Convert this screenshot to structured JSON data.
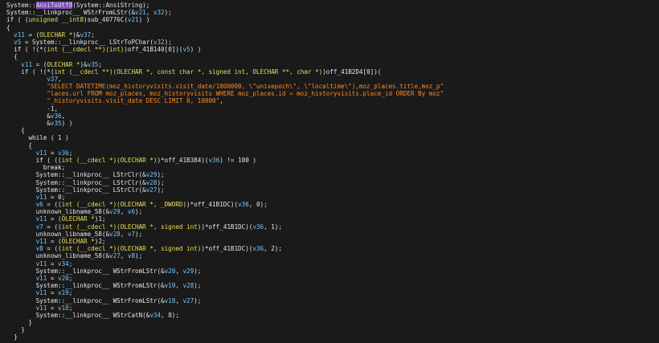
{
  "colors": {
    "background": "#1a1a1a",
    "text": "#e6e6e6",
    "type": "#e7e05a",
    "variable": "#76c8ff",
    "string": "#ff8a1f",
    "highlight": "#7a48b8"
  },
  "lines": [
    [
      [
        "plain",
        "System::"
      ],
      [
        "hl",
        "AnsiToUtf8"
      ],
      [
        "plain",
        "(System::AnsiString);"
      ]
    ],
    [
      [
        "plain",
        "System::__linkproc__ WStrFromLStr(&"
      ],
      [
        "var",
        "v21"
      ],
      [
        "plain",
        ", "
      ],
      [
        "var",
        "v32"
      ],
      [
        "plain",
        ");"
      ]
    ],
    [
      [
        "kw",
        "if"
      ],
      [
        "plain",
        " ( ("
      ],
      [
        "type",
        "unsigned __int8"
      ],
      [
        "plain",
        ")sub_40776C("
      ],
      [
        "var",
        "v21"
      ],
      [
        "plain",
        ") )"
      ]
    ],
    [
      [
        "plain",
        "{"
      ]
    ],
    [
      [
        "plain",
        "  "
      ],
      [
        "var",
        "v11"
      ],
      [
        "plain",
        " = ("
      ],
      [
        "type",
        "OLECHAR *"
      ],
      [
        "plain",
        ")&"
      ],
      [
        "var",
        "v37"
      ],
      [
        "plain",
        ";"
      ]
    ],
    [
      [
        "plain",
        "  "
      ],
      [
        "var",
        "v5"
      ],
      [
        "plain",
        " = System::__linkproc__ LStrToPChar("
      ],
      [
        "var",
        "v32"
      ],
      [
        "plain",
        ");"
      ]
    ],
    [
      [
        "plain",
        "  "
      ],
      [
        "kw",
        "if"
      ],
      [
        "plain",
        " ( !(*("
      ],
      [
        "type",
        "int (__cdecl **)(int)"
      ],
      [
        "plain",
        ")off_41B140[0])("
      ],
      [
        "var",
        "v5"
      ],
      [
        "plain",
        ") )"
      ]
    ],
    [
      [
        "plain",
        "  {"
      ]
    ],
    [
      [
        "plain",
        "    "
      ],
      [
        "var",
        "v11"
      ],
      [
        "plain",
        " = ("
      ],
      [
        "type",
        "OLECHAR *"
      ],
      [
        "plain",
        ")&"
      ],
      [
        "var",
        "v35"
      ],
      [
        "plain",
        ";"
      ]
    ],
    [
      [
        "plain",
        "    "
      ],
      [
        "kw",
        "if"
      ],
      [
        "plain",
        " ( !(*("
      ],
      [
        "type",
        "int (__cdecl **)(OLECHAR *, const char *, signed int, OLECHAR **, char *)"
      ],
      [
        "plain",
        ")off_41B2D4[0])("
      ]
    ],
    [
      [
        "plain",
        "           "
      ],
      [
        "var",
        "v37"
      ],
      [
        "plain",
        ","
      ]
    ],
    [
      [
        "plain",
        "           "
      ],
      [
        "str",
        "\"SELECT DATETIME(moz_historyvisits.visit_date/1000000, \\\"unixepoch\\\", \\\"localtime\\\"),moz_places.title,moz_p\""
      ]
    ],
    [
      [
        "plain",
        "           "
      ],
      [
        "str",
        "\"laces.url FROM moz_places, moz_historyvisits WHERE moz_places.id = moz_historyvisits.place_id ORDER By moz\""
      ]
    ],
    [
      [
        "plain",
        "           "
      ],
      [
        "str",
        "\"_historyvisits.visit_date DESC LIMIT 0, 10000\""
      ],
      [
        "plain",
        ","
      ]
    ],
    [
      [
        "plain",
        "           -"
      ],
      [
        "num",
        "1"
      ],
      [
        "plain",
        ","
      ]
    ],
    [
      [
        "plain",
        "           &"
      ],
      [
        "var",
        "v36"
      ],
      [
        "plain",
        ","
      ]
    ],
    [
      [
        "plain",
        "           &"
      ],
      [
        "var",
        "v35"
      ],
      [
        "plain",
        ") )"
      ]
    ],
    [
      [
        "plain",
        "    {"
      ]
    ],
    [
      [
        "plain",
        "      "
      ],
      [
        "kw",
        "while"
      ],
      [
        "plain",
        " ( "
      ],
      [
        "num",
        "1"
      ],
      [
        "plain",
        " )"
      ]
    ],
    [
      [
        "plain",
        "      {"
      ]
    ],
    [
      [
        "plain",
        "        "
      ],
      [
        "var",
        "v11"
      ],
      [
        "plain",
        " = "
      ],
      [
        "var",
        "v36"
      ],
      [
        "plain",
        ";"
      ]
    ],
    [
      [
        "plain",
        "        "
      ],
      [
        "kw",
        "if"
      ],
      [
        "plain",
        " ( (("
      ],
      [
        "type",
        "int (__cdecl *)(OLECHAR *)"
      ],
      [
        "plain",
        ")*off_41B384)("
      ],
      [
        "var",
        "v36"
      ],
      [
        "plain",
        ") != "
      ],
      [
        "num",
        "100"
      ],
      [
        "plain",
        " )"
      ]
    ],
    [
      [
        "plain",
        "          "
      ],
      [
        "kw",
        "break"
      ],
      [
        "plain",
        ";"
      ]
    ],
    [
      [
        "plain",
        "        System::__linkproc__ LStrClr(&"
      ],
      [
        "var",
        "v29"
      ],
      [
        "plain",
        ");"
      ]
    ],
    [
      [
        "plain",
        "        System::__linkproc__ LStrClr(&"
      ],
      [
        "var",
        "v28"
      ],
      [
        "plain",
        ");"
      ]
    ],
    [
      [
        "plain",
        "        System::__linkproc__ LStrClr(&"
      ],
      [
        "var",
        "v27"
      ],
      [
        "plain",
        ");"
      ]
    ],
    [
      [
        "plain",
        "        "
      ],
      [
        "var",
        "v11"
      ],
      [
        "plain",
        " = "
      ],
      [
        "num",
        "0"
      ],
      [
        "plain",
        ";"
      ]
    ],
    [
      [
        "plain",
        "        "
      ],
      [
        "var",
        "v6"
      ],
      [
        "plain",
        " = (("
      ],
      [
        "type",
        "int (__cdecl *)(OLECHAR *, _DWORD)"
      ],
      [
        "plain",
        ")*off_41B1DC)("
      ],
      [
        "var",
        "v36"
      ],
      [
        "plain",
        ", "
      ],
      [
        "num",
        "0"
      ],
      [
        "plain",
        ");"
      ]
    ],
    [
      [
        "plain",
        "        unknown_libname_58(&"
      ],
      [
        "var",
        "v29"
      ],
      [
        "plain",
        ", "
      ],
      [
        "var",
        "v6"
      ],
      [
        "plain",
        ");"
      ]
    ],
    [
      [
        "plain",
        "        "
      ],
      [
        "var",
        "v11"
      ],
      [
        "plain",
        " = ("
      ],
      [
        "type",
        "OLECHAR *"
      ],
      [
        "plain",
        ")"
      ],
      [
        "num",
        "1"
      ],
      [
        "plain",
        ";"
      ]
    ],
    [
      [
        "plain",
        "        "
      ],
      [
        "var",
        "v7"
      ],
      [
        "plain",
        " = (("
      ],
      [
        "type",
        "int (__cdecl *)(OLECHAR *, signed int)"
      ],
      [
        "plain",
        ")*off_41B1DC)("
      ],
      [
        "var",
        "v36"
      ],
      [
        "plain",
        ", "
      ],
      [
        "num",
        "1"
      ],
      [
        "plain",
        ");"
      ]
    ],
    [
      [
        "plain",
        "        unknown_libname_58(&"
      ],
      [
        "var",
        "v28"
      ],
      [
        "plain",
        ", "
      ],
      [
        "var",
        "v7"
      ],
      [
        "plain",
        ");"
      ]
    ],
    [
      [
        "plain",
        "        "
      ],
      [
        "var",
        "v11"
      ],
      [
        "plain",
        " = ("
      ],
      [
        "type",
        "OLECHAR *"
      ],
      [
        "plain",
        ")"
      ],
      [
        "num",
        "2"
      ],
      [
        "plain",
        ";"
      ]
    ],
    [
      [
        "plain",
        "        "
      ],
      [
        "var",
        "v8"
      ],
      [
        "plain",
        " = (("
      ],
      [
        "type",
        "int (__cdecl *)(OLECHAR *, signed int)"
      ],
      [
        "plain",
        ")*off_41B1DC)("
      ],
      [
        "var",
        "v36"
      ],
      [
        "plain",
        ", "
      ],
      [
        "num",
        "2"
      ],
      [
        "plain",
        ");"
      ]
    ],
    [
      [
        "plain",
        "        unknown_libname_58(&"
      ],
      [
        "var",
        "v27"
      ],
      [
        "plain",
        ", "
      ],
      [
        "var",
        "v8"
      ],
      [
        "plain",
        ");"
      ]
    ],
    [
      [
        "plain",
        "        "
      ],
      [
        "var",
        "v11"
      ],
      [
        "plain",
        " = "
      ],
      [
        "var",
        "v34"
      ],
      [
        "plain",
        ";"
      ]
    ],
    [
      [
        "plain",
        "        System::__linkproc__ WStrFromLStr(&"
      ],
      [
        "var",
        "v20"
      ],
      [
        "plain",
        ", "
      ],
      [
        "var",
        "v29"
      ],
      [
        "plain",
        ");"
      ]
    ],
    [
      [
        "plain",
        "        "
      ],
      [
        "var",
        "v11"
      ],
      [
        "plain",
        " = "
      ],
      [
        "var",
        "v20"
      ],
      [
        "plain",
        ";"
      ]
    ],
    [
      [
        "plain",
        "        System::__linkproc__ WStrFromLStr(&"
      ],
      [
        "var",
        "v19"
      ],
      [
        "plain",
        ", "
      ],
      [
        "var",
        "v28"
      ],
      [
        "plain",
        ");"
      ]
    ],
    [
      [
        "plain",
        "        "
      ],
      [
        "var",
        "v11"
      ],
      [
        "plain",
        " = "
      ],
      [
        "var",
        "v19"
      ],
      [
        "plain",
        ";"
      ]
    ],
    [
      [
        "plain",
        "        System::__linkproc__ WStrFromLStr(&"
      ],
      [
        "var",
        "v18"
      ],
      [
        "plain",
        ", "
      ],
      [
        "var",
        "v27"
      ],
      [
        "plain",
        ");"
      ]
    ],
    [
      [
        "plain",
        "        "
      ],
      [
        "var",
        "v11"
      ],
      [
        "plain",
        " = "
      ],
      [
        "var",
        "v18"
      ],
      [
        "plain",
        ";"
      ]
    ],
    [
      [
        "plain",
        "        System::__linkproc__ WStrCatN(&"
      ],
      [
        "var",
        "v34"
      ],
      [
        "plain",
        ", "
      ],
      [
        "num",
        "8"
      ],
      [
        "plain",
        ");"
      ]
    ],
    [
      [
        "plain",
        "      }"
      ]
    ],
    [
      [
        "plain",
        "    }"
      ]
    ],
    [
      [
        "plain",
        "  }"
      ]
    ]
  ]
}
